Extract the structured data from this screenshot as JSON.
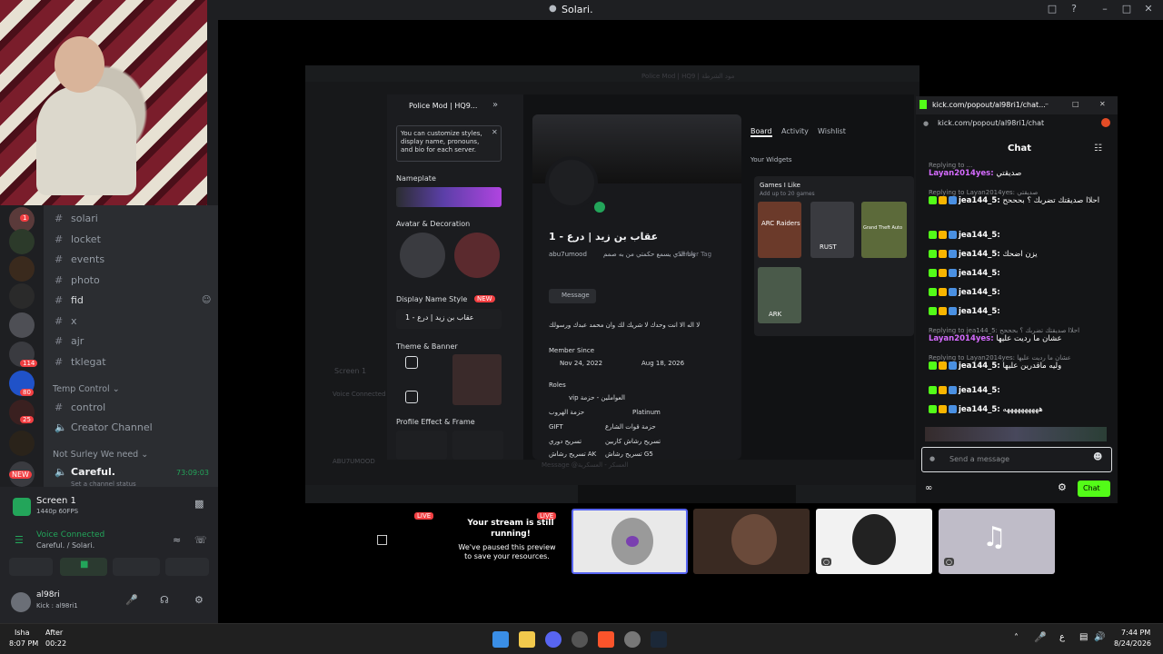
{
  "window": {
    "title": "Solari."
  },
  "servers": [
    {
      "badge": "1"
    },
    {
      "badge": ""
    },
    {
      "badge": ""
    },
    {
      "badge": ""
    },
    {
      "badge": ""
    },
    {
      "badge": "114"
    },
    {
      "badge": "80"
    },
    {
      "badge": "25"
    },
    {
      "badge": ""
    },
    {
      "badge": "NEW"
    }
  ],
  "channels": {
    "text": [
      "solari",
      "locket",
      "events",
      "photo",
      "fid",
      "x",
      "ajr",
      "tklegat"
    ],
    "category_temp": "Temp Control",
    "voice": [
      "control",
      "Creator Channel"
    ],
    "category_surley": "Not Surley We need",
    "careful": {
      "name": "Careful.",
      "timer": "73:09:03",
      "status": "Set a channel status"
    }
  },
  "panel": {
    "screen_title": "Screen 1",
    "screen_sub": "1440p 60FPS",
    "voice_status": "Voice Connected",
    "voice_sub": "Careful. / Solari.",
    "user_name": "al98ri",
    "user_status": "Kick : al98ri1"
  },
  "shared": {
    "window_title": "Police Mod | HQ9 | مود الشرطة",
    "server_name": "Police Mod | HQ9...",
    "tooltip": "You can customize styles, display name, pronouns, and bio for each server.",
    "nameplate": "Nameplate",
    "avatar_decoration": "Avatar & Decoration",
    "display_name_style": "Display Name Style",
    "new_badge": "NEW",
    "display_name_value": "عقاب بن زيد | درع - 1",
    "theme_banner": "Theme & Banner",
    "profile_effect": "Profile Effect & Frame",
    "profile_name": "عقاب بن زيد | درع - 1",
    "profile_handle": "abu7umood",
    "profile_tagline": "وانا الذي يسمع حكمتي من به صمم",
    "server_tag": "Server Tag",
    "message_button": "Message",
    "bio": "لا اله الا انت وحدك لا شريك لك وان محمد عبدك ورسولك",
    "member_since": "Member Since",
    "member_date_1": "Nov 24, 2022",
    "member_date_2": "Aug 18, 2026",
    "roles_label": "Roles",
    "roles": [
      "vip العواملين - حزمة",
      "حزمة الهروب",
      "Platinum",
      "GIFT",
      "حزمة قوات الشارع",
      "تسريح دوري",
      "تسريح رشاش كاربين",
      "تسريح رشاش AK",
      "تسريح رشاش G5"
    ],
    "tabs": [
      "Board",
      "Activity",
      "Wishlist"
    ],
    "your_widgets": "Your Widgets",
    "games_title": "Games I Like",
    "games_sub": "Add up to 20 games",
    "game_labels": [
      "ARC Raiders",
      "RUST",
      "Grand Theft Auto",
      "ARK"
    ],
    "screen_label": "Screen 1",
    "voice_connected": "Voice Connected",
    "user_tag": "ABU7UMOOD",
    "message_placeholder": "Message @العسكر - العسكرية"
  },
  "kick": {
    "window_title": "kick.com/popout/al98ri1/chat...",
    "url": "kick.com/popout/al98ri1/chat",
    "chat_title": "Chat",
    "messages": [
      {
        "reply": "Replying to ...",
        "user": "Layan2014yes:",
        "text": "صديقتي"
      },
      {
        "reply": "Replying to Layan2014yes: صديقتي",
        "user": "jea144_5:",
        "text": "احلاا صديقتك تضربك ؟ بحححح"
      },
      {
        "reply": "",
        "user": "jea144_5:",
        "text": ""
      },
      {
        "reply": "",
        "user": "jea144_5:",
        "text": "يزن اضحك"
      },
      {
        "reply": "",
        "user": "jea144_5:",
        "text": ""
      },
      {
        "reply": "",
        "user": "jea144_5:",
        "text": ""
      },
      {
        "reply": "",
        "user": "jea144_5:",
        "text": ""
      },
      {
        "reply": "Replying to jea144_5: احلاا صديقتك تضربك ؟ بحححح",
        "user": "Layan2014yes:",
        "text": "عشان ما رديت عليها"
      },
      {
        "reply": "Replying to Layan2014yes: عشان ما رديت عليها",
        "user": "jea144_5:",
        "text": "وليه ماقدرين عليها"
      },
      {
        "reply": "",
        "user": "jea144_5:",
        "text": ""
      },
      {
        "reply": "",
        "user": "jea144_5:",
        "text": "ههههههههههه"
      }
    ],
    "input_placeholder": "Send a message",
    "chat_button": "Chat"
  },
  "previews": {
    "paused_title": "Your stream is still running!",
    "paused_sub": "We've paused this preview to save your resources.",
    "live": "LIVE"
  },
  "taskbar": {
    "left_line1": "Isha",
    "left_line2": "8:07 PM",
    "mid_line1": "After",
    "mid_line2": "00:22",
    "lang": "ع",
    "time": "7:44 PM",
    "date": "8/24/2026"
  }
}
